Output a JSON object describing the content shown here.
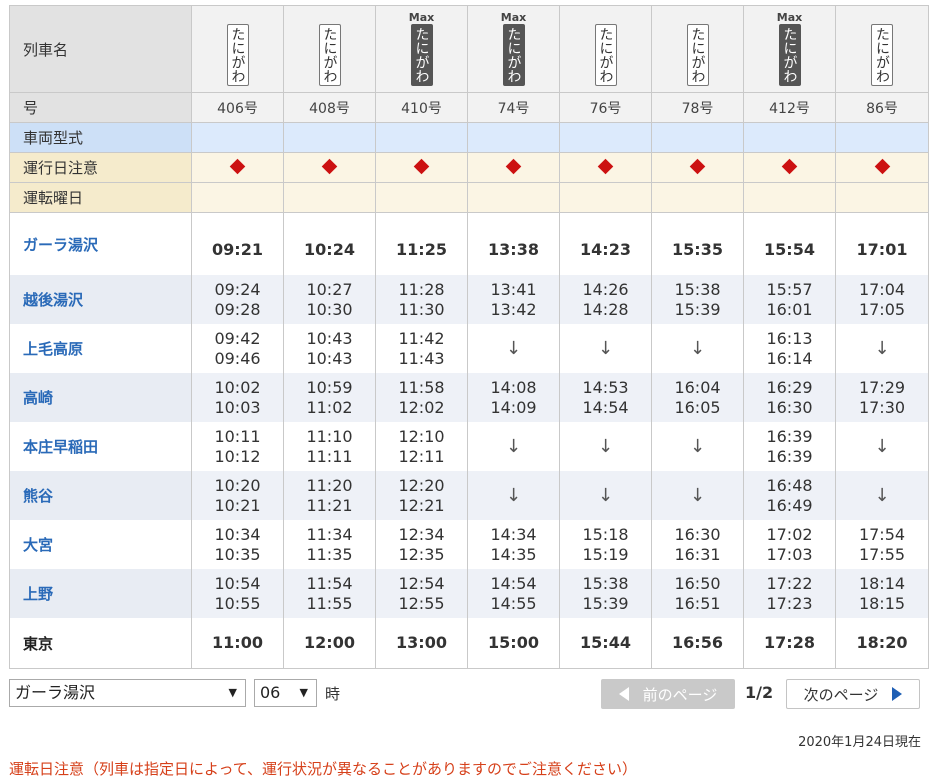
{
  "row_labels": {
    "train_name": "列車名",
    "number": "号",
    "car_type": "車両型式",
    "date_note": "運行日注意",
    "weekdays": "運転曜日"
  },
  "trains": [
    {
      "name": "たにがわ",
      "max": "",
      "number": "406号"
    },
    {
      "name": "たにがわ",
      "max": "",
      "number": "408号"
    },
    {
      "name": "たにがわ",
      "max": "Max",
      "number": "410号"
    },
    {
      "name": "たにがわ",
      "max": "Max",
      "number": "74号"
    },
    {
      "name": "たにがわ",
      "max": "",
      "number": "76号"
    },
    {
      "name": "たにがわ",
      "max": "",
      "number": "78号"
    },
    {
      "name": "たにがわ",
      "max": "Max",
      "number": "412号"
    },
    {
      "name": "たにがわ",
      "max": "",
      "number": "86号"
    }
  ],
  "stations": [
    {
      "name": "ガーラ湯沢",
      "times": [
        [
          "09:21"
        ],
        [
          "10:24"
        ],
        [
          "11:25"
        ],
        [
          "13:38"
        ],
        [
          "14:23"
        ],
        [
          "15:35"
        ],
        [
          "15:54"
        ],
        [
          "17:01"
        ]
      ]
    },
    {
      "name": "越後湯沢",
      "times": [
        [
          "09:24",
          "09:28"
        ],
        [
          "10:27",
          "10:30"
        ],
        [
          "11:28",
          "11:30"
        ],
        [
          "13:41",
          "13:42"
        ],
        [
          "14:26",
          "14:28"
        ],
        [
          "15:38",
          "15:39"
        ],
        [
          "15:57",
          "16:01"
        ],
        [
          "17:04",
          "17:05"
        ]
      ]
    },
    {
      "name": "上毛高原",
      "times": [
        [
          "09:42",
          "09:46"
        ],
        [
          "10:43",
          "10:43"
        ],
        [
          "11:42",
          "11:43"
        ],
        [
          "↓"
        ],
        [
          "↓"
        ],
        [
          "↓"
        ],
        [
          "16:13",
          "16:14"
        ],
        [
          "↓"
        ]
      ]
    },
    {
      "name": "高崎",
      "times": [
        [
          "10:02",
          "10:03"
        ],
        [
          "10:59",
          "11:02"
        ],
        [
          "11:58",
          "12:02"
        ],
        [
          "14:08",
          "14:09"
        ],
        [
          "14:53",
          "14:54"
        ],
        [
          "16:04",
          "16:05"
        ],
        [
          "16:29",
          "16:30"
        ],
        [
          "17:29",
          "17:30"
        ]
      ]
    },
    {
      "name": "本庄早稲田",
      "times": [
        [
          "10:11",
          "10:12"
        ],
        [
          "11:10",
          "11:11"
        ],
        [
          "12:10",
          "12:11"
        ],
        [
          "↓"
        ],
        [
          "↓"
        ],
        [
          "↓"
        ],
        [
          "16:39",
          "16:39"
        ],
        [
          "↓"
        ]
      ]
    },
    {
      "name": "熊谷",
      "times": [
        [
          "10:20",
          "10:21"
        ],
        [
          "11:20",
          "11:21"
        ],
        [
          "12:20",
          "12:21"
        ],
        [
          "↓"
        ],
        [
          "↓"
        ],
        [
          "↓"
        ],
        [
          "16:48",
          "16:49"
        ],
        [
          "↓"
        ]
      ]
    },
    {
      "name": "大宮",
      "times": [
        [
          "10:34",
          "10:35"
        ],
        [
          "11:34",
          "11:35"
        ],
        [
          "12:34",
          "12:35"
        ],
        [
          "14:34",
          "14:35"
        ],
        [
          "15:18",
          "15:19"
        ],
        [
          "16:30",
          "16:31"
        ],
        [
          "17:02",
          "17:03"
        ],
        [
          "17:54",
          "17:55"
        ]
      ]
    },
    {
      "name": "上野",
      "times": [
        [
          "10:54",
          "10:55"
        ],
        [
          "11:54",
          "11:55"
        ],
        [
          "12:54",
          "12:55"
        ],
        [
          "14:54",
          "14:55"
        ],
        [
          "15:38",
          "15:39"
        ],
        [
          "16:50",
          "16:51"
        ],
        [
          "17:22",
          "17:23"
        ],
        [
          "18:14",
          "18:15"
        ]
      ]
    },
    {
      "name": "東京",
      "times": [
        [
          "11:00"
        ],
        [
          "12:00"
        ],
        [
          "13:00"
        ],
        [
          "15:00"
        ],
        [
          "15:44"
        ],
        [
          "16:56"
        ],
        [
          "17:28"
        ],
        [
          "18:20"
        ]
      ]
    }
  ],
  "controls": {
    "station_select": "ガーラ湯沢",
    "hour_select": "06",
    "hour_suffix": "時",
    "prev_label": "前のページ",
    "page_indicator": "1/2",
    "next_label": "次のページ"
  },
  "as_of": "2020年1月24日現在",
  "footnote": "運転日注意（列車は指定日によって、運行状況が異なることがありますのでご注意ください）",
  "colors": {
    "diamond": "#cc1111",
    "station_link": "#2a6ab8",
    "note": "#d6401a",
    "next_arrow": "#1f5fb5"
  }
}
